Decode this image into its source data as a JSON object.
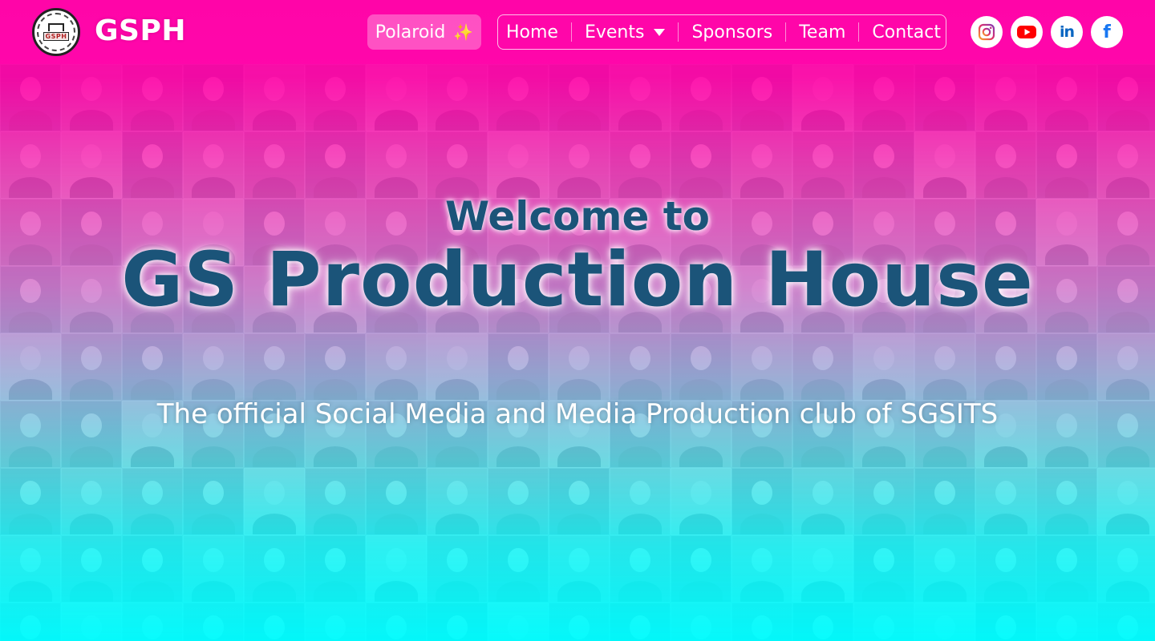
{
  "header": {
    "brand": "GSPH",
    "logo_text": "GSPH",
    "polaroid_label": "Polaroid",
    "nav": [
      {
        "label": "Home"
      },
      {
        "label": "Events"
      },
      {
        "label": "Sponsors"
      },
      {
        "label": "Team"
      },
      {
        "label": "Contact"
      }
    ],
    "socials": [
      "instagram-icon",
      "youtube-icon",
      "linkedin-icon",
      "facebook-icon"
    ]
  },
  "hero": {
    "welcome": "Welcome to",
    "title": "GS Production House",
    "subtitle": "The official Social Media and Media Production club of SGSITS"
  },
  "colors": {
    "top": "#ff05a8",
    "bottom": "#00fdff",
    "title": "#1b5479",
    "white": "#ffffff"
  }
}
